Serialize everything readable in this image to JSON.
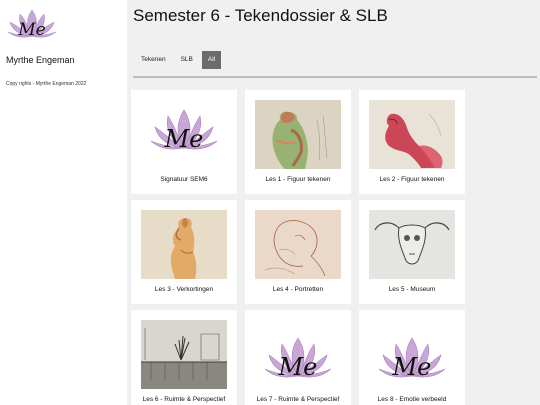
{
  "sidebar": {
    "owner_name": "Myrthe Engeman",
    "copyright": "Copy rights - Myrthe Engeman 2022",
    "logo_text": "Me"
  },
  "header": {
    "title": "Semester 6 - Tekendossier & SLB"
  },
  "filters": [
    {
      "label": "Tekenen",
      "active": false
    },
    {
      "label": "SLB",
      "active": false
    },
    {
      "label": "All",
      "active": true
    }
  ],
  "cards": [
    {
      "caption": "Signatuur SEM6",
      "image": "logo"
    },
    {
      "caption": "Les 1 - Figuur tekenen",
      "image": "figure-green"
    },
    {
      "caption": "Les 2 - Figuur tekenen",
      "image": "figure-red"
    },
    {
      "caption": "Les 3 - Verkortingen",
      "image": "figure-warm"
    },
    {
      "caption": "Les 4 - Portretten",
      "image": "portrait-sketch"
    },
    {
      "caption": "Les 5 - Museum",
      "image": "skull-sketch"
    },
    {
      "caption": "Les 6 - Ruimte & Perspectief",
      "image": "room-sketch"
    },
    {
      "caption": "Les 7 - Ruimte & Perspectief",
      "image": "logo"
    },
    {
      "caption": "Les 8 - Emotie verbeeld",
      "image": "logo"
    }
  ],
  "colors": {
    "lotus": "#c9a6d6",
    "lotus_dark": "#9c74b0",
    "active_filter": "#6b6b6b",
    "page_bg": "#f0f0f0"
  }
}
